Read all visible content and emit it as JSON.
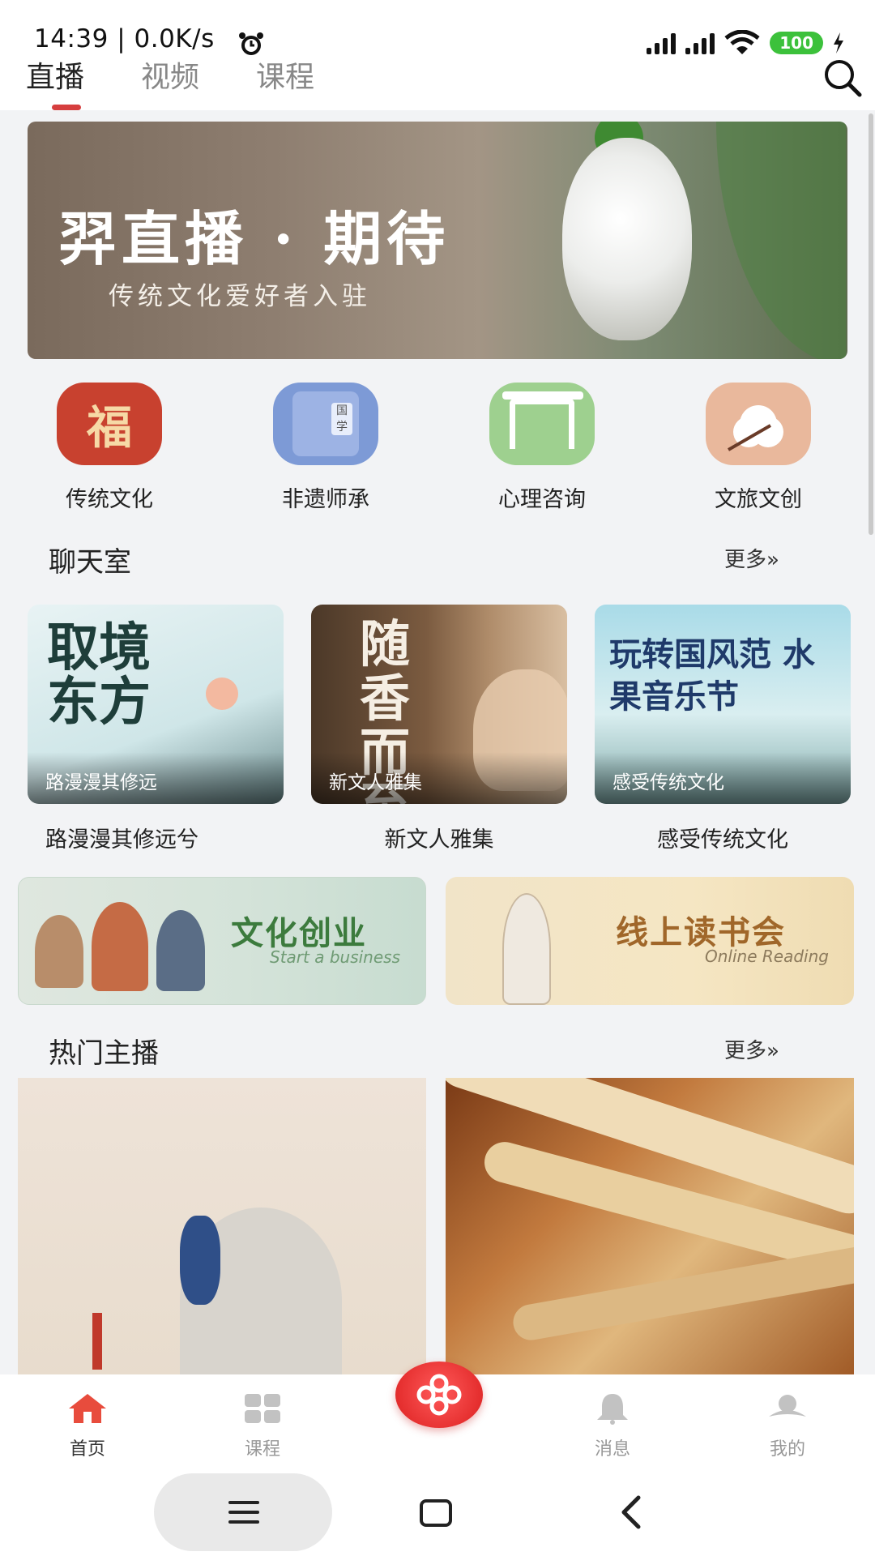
{
  "status": {
    "time": "14:39 | 0.0K/s",
    "battery": "100"
  },
  "tabs": [
    "直播",
    "视频",
    "课程"
  ],
  "banner": {
    "title": "羿直播 · 期待",
    "subtitle": "传统文化爱好者入驻"
  },
  "categories": [
    {
      "label": "传统文化",
      "glyph": "福"
    },
    {
      "label": "非遗师承",
      "glyph": "国学"
    },
    {
      "label": "心理咨询"
    },
    {
      "label": "文旅文创"
    }
  ],
  "chat": {
    "title": "聊天室",
    "more": "更多»",
    "cards": [
      {
        "overlay": "路漫漫其修远",
        "title": "路漫漫其修远兮",
        "art": "取境东方"
      },
      {
        "overlay": "新文人雅集",
        "title": "新文人雅集",
        "art": "随香而至"
      },
      {
        "overlay": "感受传统文化",
        "title": "感受传统文化",
        "art": "玩转国风范 水果音乐节"
      }
    ]
  },
  "features": [
    {
      "title": "文化创业",
      "subtitle": "Start a business"
    },
    {
      "title": "线上读书会",
      "subtitle": "Online Reading"
    }
  ],
  "hot": {
    "title": "热门主播",
    "more": "更多»"
  },
  "bottom_nav": [
    {
      "label": "首页",
      "icon": "home-icon"
    },
    {
      "label": "课程",
      "icon": "grid-icon"
    },
    {
      "label": "",
      "icon": "knot-icon"
    },
    {
      "label": "消息",
      "icon": "bell-icon"
    },
    {
      "label": "我的",
      "icon": "profile-icon"
    }
  ],
  "colors": {
    "accent": "#d63e3e",
    "active_tab": "#222222",
    "inactive": "#888888"
  }
}
